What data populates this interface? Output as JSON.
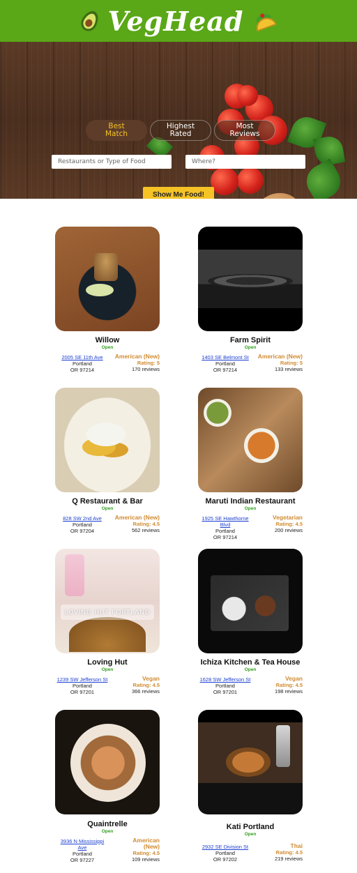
{
  "header": {
    "title": "VegHead"
  },
  "hero": {
    "tabs": [
      "Best Match",
      "Highest Rated",
      "Most Reviews"
    ],
    "active_tab": "Best Match",
    "food_placeholder": "Restaurants or Type of Food",
    "where_placeholder": "Where?",
    "search_button": "Show Me Food!"
  },
  "results": [
    {
      "name": "Willow",
      "status": "Open",
      "street": "2005 SE 11th Ave",
      "city": "Portland",
      "state_zip": "OR 97214",
      "cuisine": "American (New)",
      "rating": "Rating: 5",
      "reviews": "170 reviews"
    },
    {
      "name": "Farm Spirit",
      "status": "Open",
      "street": "1403 SE Belmont St",
      "city": "Portland",
      "state_zip": "OR 97214",
      "cuisine": "American (New)",
      "rating": "Rating: 5",
      "reviews": "133 reviews"
    },
    {
      "name": "Q Restaurant & Bar",
      "status": "Open",
      "street": "828 SW 2nd Ave",
      "city": "Portland",
      "state_zip": "OR 97204",
      "cuisine": "American (New)",
      "rating": "Rating: 4.5",
      "reviews": "562 reviews"
    },
    {
      "name": "Maruti Indian Restaurant",
      "status": "Open",
      "street": "1925 SE Hawthorne Blvd",
      "city": "Portland",
      "state_zip": "OR 97214",
      "cuisine": "Vegetarian",
      "rating": "Rating: 4.5",
      "reviews": "200 reviews"
    },
    {
      "name": "Loving Hut",
      "status": "Open",
      "street": "1239 SW Jefferson St",
      "city": "Portland",
      "state_zip": "OR 97201",
      "cuisine": "Vegan",
      "rating": "Rating: 4.5",
      "reviews": "366 reviews",
      "photo_caption": "LOVING HUT PORTLAND"
    },
    {
      "name": "Ichiza Kitchen & Tea House",
      "status": "Open",
      "street": "1628 SW Jefferson St",
      "city": "Portland",
      "state_zip": "OR 97201",
      "cuisine": "Vegan",
      "rating": "Rating: 4.5",
      "reviews": "198 reviews"
    },
    {
      "name": "Quaintrelle",
      "status": "Open",
      "street": "3936 N Mississippi Ave",
      "city": "Portland",
      "state_zip": "OR 97227",
      "cuisine": "American (New)",
      "rating": "Rating: 4.5",
      "reviews": "109 reviews"
    },
    {
      "name": "Kati Portland",
      "status": "Open",
      "street": "2932 SE Division St",
      "city": "Portland",
      "state_zip": "OR 97202",
      "cuisine": "Thai",
      "rating": "Rating: 4.5",
      "reviews": "219 reviews"
    }
  ],
  "colors": {
    "brand_green": "#5aa717",
    "accent_yellow": "#f5c325",
    "open_green": "#2f9d1b",
    "cuisine_gold": "#d08b32",
    "link_blue": "#1c3fd0"
  }
}
